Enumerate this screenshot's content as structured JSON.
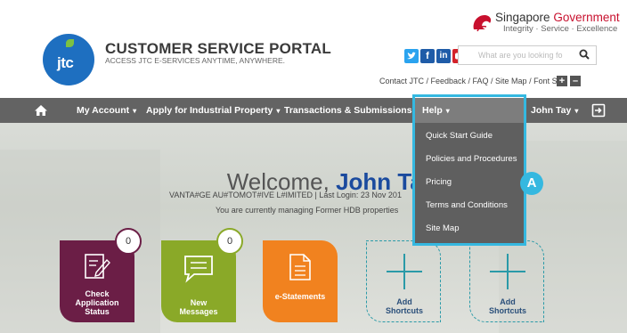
{
  "header": {
    "portal_title": "CUSTOMER SERVICE PORTAL",
    "portal_subtitle": "ACCESS JTC E-SERVICES ANYTIME, ANYWHERE.",
    "logo_text": "jtc",
    "gov_title_1": "Singapore ",
    "gov_title_2": "Government",
    "gov_tagline": "Integrity · Service · Excellence",
    "search_placeholder": "What are you looking fo",
    "top_links": "Contact JTC  / Feedback  / FAQ  / Site Map  / Font Size",
    "social_icons": [
      "twitter-icon",
      "facebook-icon",
      "linkedin-icon",
      "youtube-icon"
    ]
  },
  "nav": {
    "items": [
      {
        "label": "My Account",
        "caret": "▾"
      },
      {
        "label": "Apply for Industrial Property",
        "caret": "▾"
      },
      {
        "label": "Transactions & Submissions",
        "caret": "▾"
      },
      {
        "label": "Help",
        "caret": "▾"
      },
      {
        "label": "John Tay",
        "caret": "▾"
      }
    ]
  },
  "help_menu": {
    "items": [
      "Quick Start Guide",
      "Policies and Procedures",
      "Pricing",
      "Terms and Conditions",
      "Site Map"
    ],
    "callout": "A"
  },
  "welcome": {
    "prefix": "Welcome, ",
    "name": "John Tay",
    "account_line": "VANTA#GE AU#TOMOT#IVE L#IMITED  |  Last Login: 23 Nov 201",
    "managing": "You are currently managing Former HDB properties"
  },
  "tiles": [
    {
      "label_1": "Check",
      "label_2": "Application",
      "label_3": "Status",
      "badge": "0"
    },
    {
      "label_1": "New",
      "label_2": "Messages",
      "badge": "0"
    },
    {
      "label_1": "e-Statements"
    },
    {
      "label_1": "Add",
      "label_2": "Shortcuts"
    },
    {
      "label_1": "Add",
      "label_2": "Shortcuts"
    }
  ],
  "colors": {
    "nav_bg": "#636363",
    "highlight": "#35b8e0",
    "check_tile": "#6b1e46",
    "messages_tile": "#8aa928",
    "estatements_tile": "#f1821f",
    "welcome_name": "#1a4a9e"
  }
}
